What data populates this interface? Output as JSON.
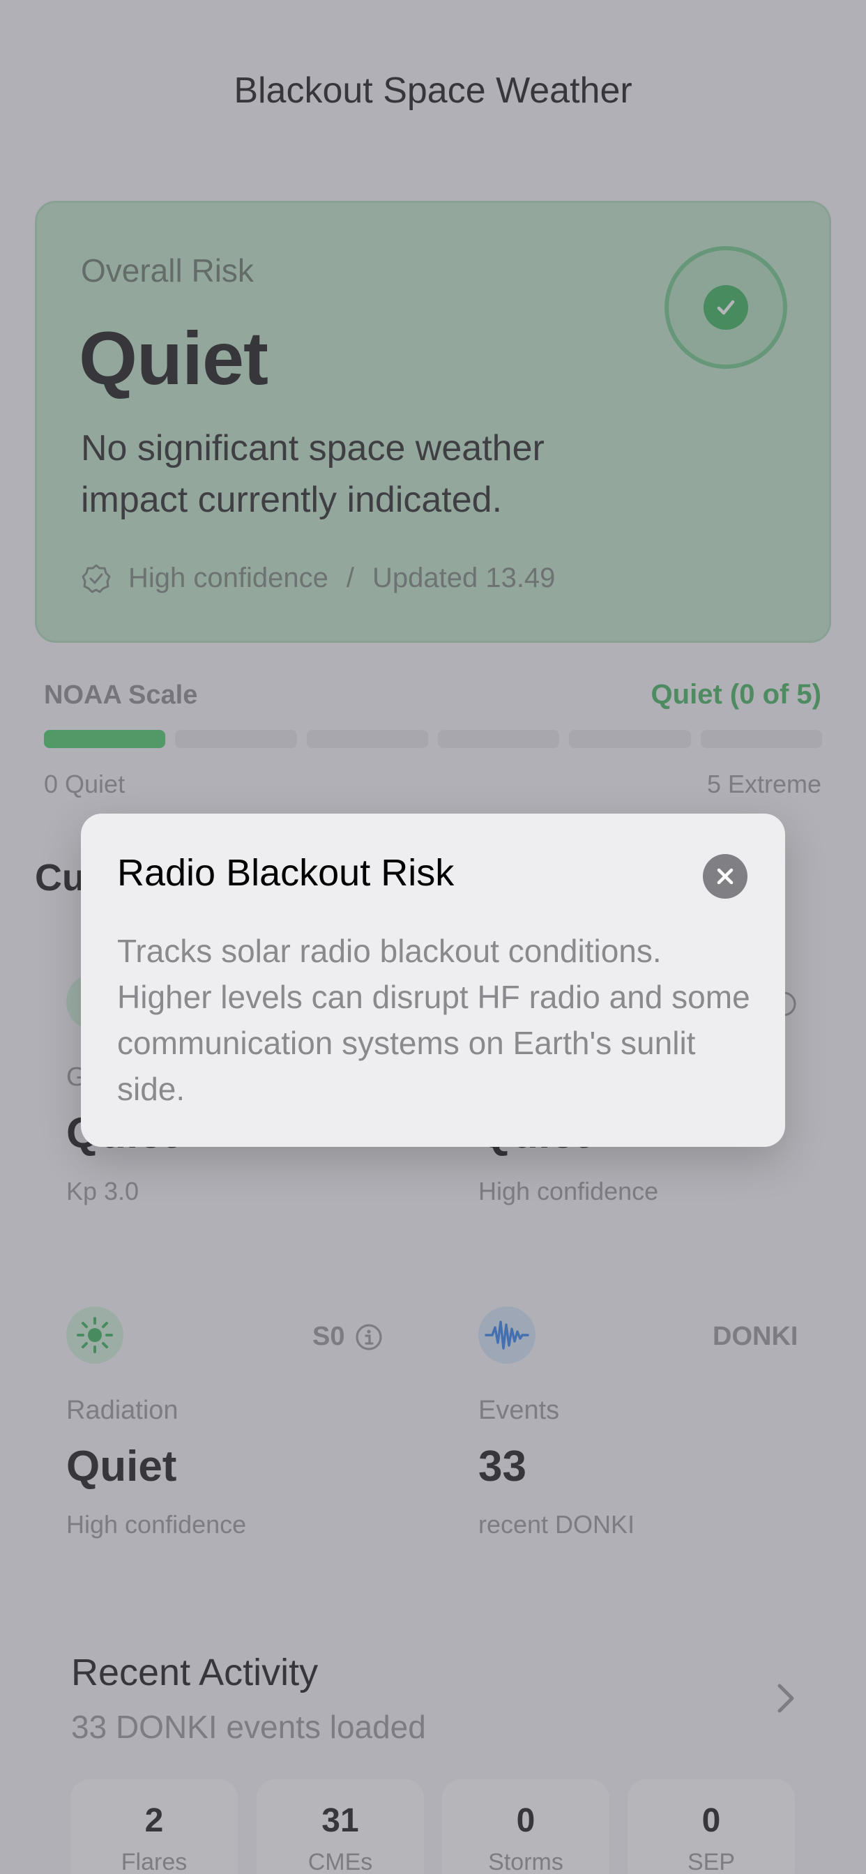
{
  "app": {
    "title": "Blackout Space Weather"
  },
  "overall": {
    "label": "Overall Risk",
    "status": "Quiet",
    "description": "No significant space weather impact currently indicated.",
    "confidence": "High confidence",
    "separator": "/",
    "updated": "Updated 13.49",
    "status_icon": "checkmark-icon",
    "accent": "#34c759"
  },
  "noaa": {
    "label": "NOAA Scale",
    "value": "Quiet (0 of 5)",
    "level": 0,
    "max_level": 5,
    "min_label": "0 Quiet",
    "max_label": "5 Extreme"
  },
  "current": {
    "title_visible": "Cu",
    "geomagnetic": {
      "label_visible": "G",
      "value": "Quiet",
      "sub": "Kp 3.0",
      "icon": "geomagnetic-icon"
    },
    "radio": {
      "value": "Quiet",
      "sub": "High confidence"
    },
    "radiation": {
      "label": "Radiation",
      "value": "Quiet",
      "sub": "High confidence",
      "badge": "S0",
      "icon": "sun-icon"
    },
    "events": {
      "label": "Events",
      "value": "33",
      "sub": "recent DONKI",
      "badge": "DONKI",
      "icon": "waveform-icon"
    }
  },
  "recent": {
    "title": "Recent Activity",
    "subtitle": "33 DONKI events loaded",
    "stats": [
      {
        "value": "2",
        "label": "Flares"
      },
      {
        "value": "31",
        "label": "CMEs"
      },
      {
        "value": "0",
        "label": "Storms"
      },
      {
        "value": "0",
        "label": "SEP"
      }
    ]
  },
  "dialog": {
    "title": "Radio Blackout Risk",
    "body": "Tracks solar radio blackout conditions. Higher levels can disrupt HF radio and some communication systems on Earth's sunlit side."
  }
}
